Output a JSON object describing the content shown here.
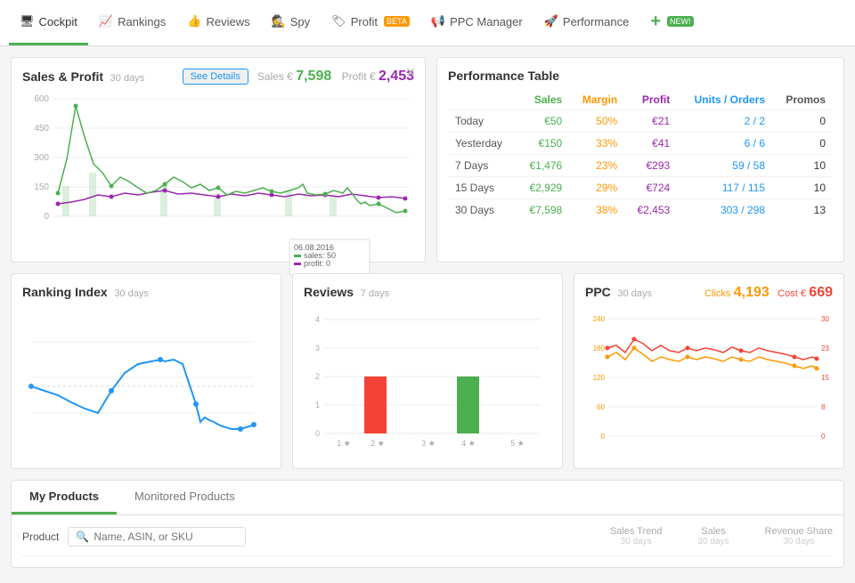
{
  "nav": {
    "items": [
      {
        "id": "cockpit",
        "label": "Cockpit",
        "icon": "🖥",
        "active": true
      },
      {
        "id": "rankings",
        "label": "Rankings",
        "icon": "📈"
      },
      {
        "id": "reviews",
        "label": "Reviews",
        "icon": "👍"
      },
      {
        "id": "spy",
        "label": "Spy",
        "icon": "🕵"
      },
      {
        "id": "profit",
        "label": "Profit",
        "icon": "🏷",
        "badge": "BETA"
      },
      {
        "id": "ppc-manager",
        "label": "PPC Manager",
        "icon": "📢"
      },
      {
        "id": "performance",
        "label": "Performance",
        "icon": "🚀"
      },
      {
        "id": "plus",
        "label": "+",
        "badge_new": "NEW!"
      }
    ]
  },
  "sales_profit": {
    "title": "Sales & Profit",
    "period": "30 days",
    "see_details": "See Details",
    "sales_label": "Sales €",
    "sales_value": "7,598",
    "profit_label": "Profit €",
    "profit_value": "2,453",
    "tooltip_date": "06.08.2016",
    "tooltip_sales": "sales: 50",
    "tooltip_profit": "profit: 0",
    "y_labels": [
      "600",
      "450",
      "300",
      "150",
      "0"
    ]
  },
  "performance_table": {
    "title": "Performance Table",
    "columns": [
      "Sales",
      "Margin",
      "Profit",
      "Units / Orders",
      "Promos"
    ],
    "rows": [
      {
        "label": "Today",
        "sales": "€50",
        "margin": "50%",
        "profit": "€21",
        "units": "2 / 2",
        "promos": "0"
      },
      {
        "label": "Yesterday",
        "sales": "€150",
        "margin": "33%",
        "profit": "€41",
        "units": "6 / 6",
        "promos": "0"
      },
      {
        "label": "7 Days",
        "sales": "€1,476",
        "margin": "23%",
        "profit": "€293",
        "units": "59 / 58",
        "promos": "10"
      },
      {
        "label": "15 Days",
        "sales": "€2,929",
        "margin": "29%",
        "profit": "€724",
        "units": "117 / 115",
        "promos": "10"
      },
      {
        "label": "30 Days",
        "sales": "€7,598",
        "margin": "38%",
        "profit": "€2,453",
        "units": "303 / 298",
        "promos": "13"
      }
    ]
  },
  "ranking_index": {
    "title": "Ranking Index",
    "period": "30 days"
  },
  "reviews": {
    "title": "Reviews",
    "period": "7 days",
    "y_labels": [
      "4",
      "3",
      "2",
      "1",
      "0"
    ],
    "x_labels": [
      "1 ★",
      "2 ★",
      "3 ★",
      "4 ★",
      "5 ★"
    ]
  },
  "ppc": {
    "title": "PPC",
    "period": "30 days",
    "clicks_label": "Clicks",
    "clicks_value": "4,193",
    "cost_label": "Cost €",
    "cost_value": "669",
    "y_labels_left": [
      "240",
      "180",
      "120",
      "60",
      "0"
    ],
    "y_labels_right": [
      "30",
      "23",
      "15",
      "8",
      "0"
    ]
  },
  "products": {
    "tabs": [
      "My Products",
      "Monitored Products"
    ],
    "active_tab": "My Products",
    "filter_label": "Product",
    "search_placeholder": "Name, ASIN, or SKU",
    "columns": [
      {
        "label": "Sales Trend",
        "sub": "30 days"
      },
      {
        "label": "Sales",
        "sub": "30 days"
      },
      {
        "label": "Revenue Share",
        "sub": "30 days"
      }
    ]
  }
}
